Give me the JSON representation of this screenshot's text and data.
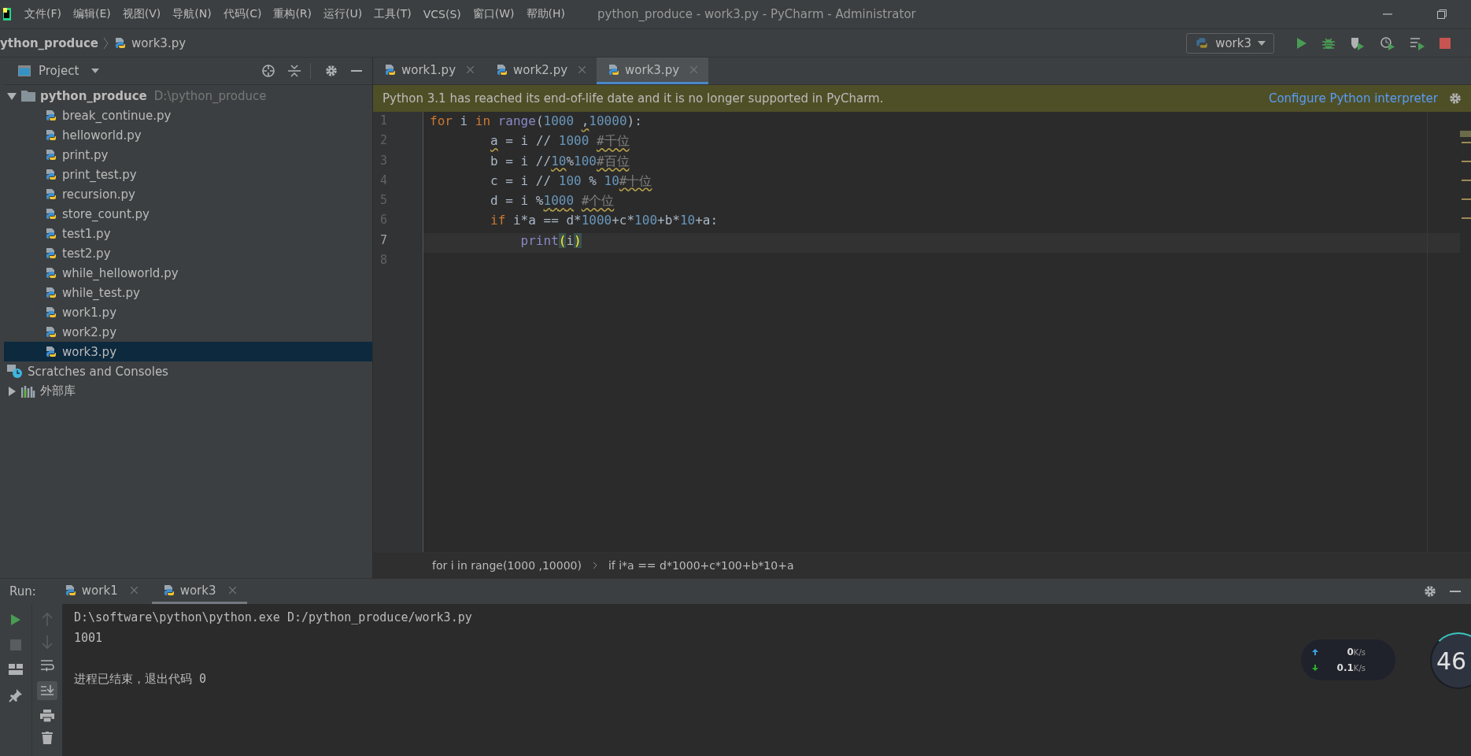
{
  "menu": [
    "文件(F)",
    "编辑(E)",
    "视图(V)",
    "导航(N)",
    "代码(C)",
    "重构(R)",
    "运行(U)",
    "工具(T)",
    "VCS(S)",
    "窗口(W)",
    "帮助(H)"
  ],
  "window": {
    "title": "python_produce - work3.py - PyCharm - Administrator"
  },
  "breadcrumb": [
    "ython_produce",
    "work3.py"
  ],
  "run_config": {
    "label": "work3"
  },
  "project_panel": {
    "title": "Project",
    "root": {
      "name": "python_produce",
      "path": "D:\\python_produce",
      "expanded": true,
      "children": [
        {
          "name": "break_continue.py",
          "selected": false
        },
        {
          "name": "helloworld.py",
          "selected": false
        },
        {
          "name": "print.py",
          "selected": false
        },
        {
          "name": "print_test.py",
          "selected": false
        },
        {
          "name": "recursion.py",
          "selected": false
        },
        {
          "name": "store_count.py",
          "selected": false
        },
        {
          "name": "test1.py",
          "selected": false
        },
        {
          "name": "test2.py",
          "selected": false
        },
        {
          "name": "while_helloworld.py",
          "selected": false
        },
        {
          "name": "while_test.py",
          "selected": false
        },
        {
          "name": "work1.py",
          "selected": false
        },
        {
          "name": "work2.py",
          "selected": false
        },
        {
          "name": "work3.py",
          "selected": true
        }
      ]
    },
    "extra": [
      {
        "kind": "scratches",
        "name": "Scratches and Consoles",
        "expanded": false
      },
      {
        "kind": "libraries",
        "name": "外部库",
        "expanded": false
      }
    ]
  },
  "editor_tabs": [
    {
      "label": "work1.py",
      "selected": false
    },
    {
      "label": "work2.py",
      "selected": false
    },
    {
      "label": "work3.py",
      "selected": true
    }
  ],
  "warning_bar": {
    "message": "Python 3.1 has reached its end-of-life date and it is no longer supported in PyCharm.",
    "link": "Configure Python interpreter"
  },
  "code": [
    {
      "number": "1",
      "current": false,
      "tokens": [
        {
          "kind": "keyword",
          "text": "for"
        },
        {
          "kind": "plain",
          "text": " i "
        },
        {
          "kind": "keyword",
          "text": "in"
        },
        {
          "kind": "builtin",
          "text": " range"
        },
        {
          "kind": "plain",
          "text": "("
        },
        {
          "kind": "number",
          "text": "1000"
        },
        {
          "kind": "plain",
          "text": " ,",
          "warning": true
        },
        {
          "kind": "number",
          "text": "10000"
        },
        {
          "kind": "plain",
          "text": "):"
        }
      ]
    },
    {
      "number": "2",
      "current": false,
      "tokens": [
        {
          "kind": "plain",
          "text": "        a",
          "warning": true
        },
        {
          "kind": "plain",
          "text": " = i // "
        },
        {
          "kind": "number",
          "text": "1000"
        },
        {
          "kind": "comment",
          "text": " #千位",
          "warning": true
        }
      ]
    },
    {
      "number": "3",
      "current": false,
      "tokens": [
        {
          "kind": "plain",
          "text": "        b = i //"
        },
        {
          "kind": "number",
          "text": "10",
          "warning": true
        },
        {
          "kind": "plain",
          "text": "%"
        },
        {
          "kind": "number",
          "text": "100"
        },
        {
          "kind": "comment",
          "text": "#百位",
          "warning": true
        }
      ]
    },
    {
      "number": "4",
      "current": false,
      "tokens": [
        {
          "kind": "plain",
          "text": "        c = i // "
        },
        {
          "kind": "number",
          "text": "100"
        },
        {
          "kind": "plain",
          "text": " % "
        },
        {
          "kind": "number",
          "text": "10"
        },
        {
          "kind": "comment",
          "text": "#十位",
          "warning": true
        }
      ]
    },
    {
      "number": "5",
      "current": false,
      "tokens": [
        {
          "kind": "plain",
          "text": "        d = i %"
        },
        {
          "kind": "number",
          "text": "1000",
          "warning": true
        },
        {
          "kind": "comment",
          "text": " #个位",
          "warning": true
        }
      ]
    },
    {
      "number": "6",
      "current": false,
      "tokens": [
        {
          "kind": "keyword",
          "text": "        if"
        },
        {
          "kind": "plain",
          "text": " i*a == d*"
        },
        {
          "kind": "number",
          "text": "1000"
        },
        {
          "kind": "plain",
          "text": "+c*"
        },
        {
          "kind": "number",
          "text": "100"
        },
        {
          "kind": "plain",
          "text": "+b*"
        },
        {
          "kind": "number",
          "text": "10"
        },
        {
          "kind": "plain",
          "text": "+a:"
        }
      ]
    },
    {
      "number": "7",
      "current": true,
      "tokens": [
        {
          "kind": "builtin",
          "text": "            print"
        },
        {
          "kind": "bracket",
          "text": "("
        },
        {
          "kind": "plain",
          "text": "i"
        },
        {
          "kind": "bracket",
          "text": ")"
        }
      ]
    },
    {
      "number": "8",
      "current": false
    }
  ],
  "editor_breadcrumb": [
    "for i in range(1000 ,10000)",
    "if i*a == d*1000+c*100+b*10+a"
  ],
  "run_panel": {
    "label": "Run:",
    "tabs": [
      {
        "label": "work1",
        "selected": false
      },
      {
        "label": "work3",
        "selected": true
      }
    ],
    "output": [
      "D:\\software\\python\\python.exe D:/python_produce/work3.py",
      "1001"
    ],
    "exit_message": "进程已结束，退出代码 0"
  },
  "network_widget": {
    "upload": "0",
    "download": "0.1",
    "unit_up": "K/s",
    "unit_down": "K/s",
    "percent": "46"
  }
}
